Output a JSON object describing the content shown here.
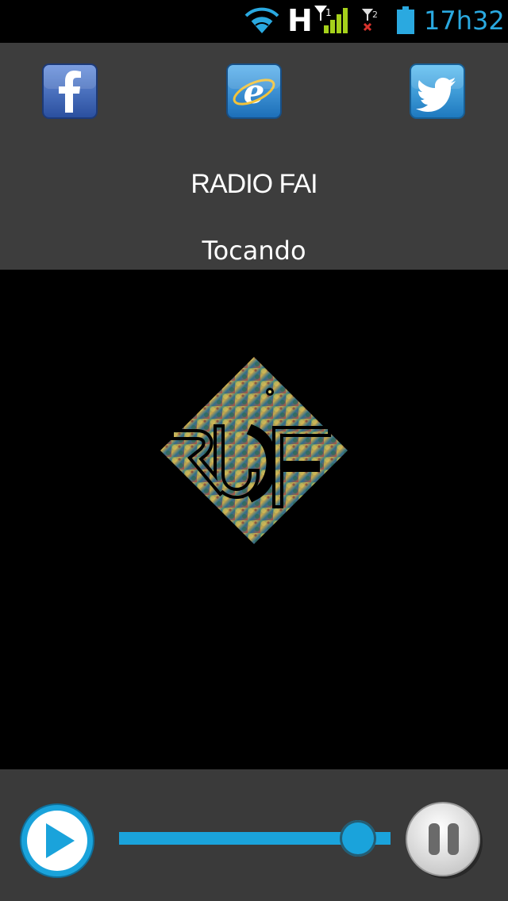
{
  "status_bar": {
    "network_type": "H",
    "time": "17h32",
    "icons": [
      "wifi-icon",
      "signal-sim1-icon",
      "signal-sim2-icon",
      "battery-icon"
    ]
  },
  "header": {
    "social_links": [
      {
        "name": "facebook",
        "icon": "facebook-icon",
        "color": "#3b63b4"
      },
      {
        "name": "website",
        "icon": "internet-explorer-icon",
        "color": "#2e8fd6"
      },
      {
        "name": "twitter",
        "icon": "twitter-icon",
        "color": "#2f9ad8"
      }
    ],
    "station_name": "RADIO FAI",
    "status": "Tocando"
  },
  "artwork": {
    "logo": "radio-fai-logo"
  },
  "player": {
    "play_icon": "play-icon",
    "pause_icon": "pause-icon",
    "volume_level": 0.88,
    "accent_color": "#1aa3db"
  }
}
